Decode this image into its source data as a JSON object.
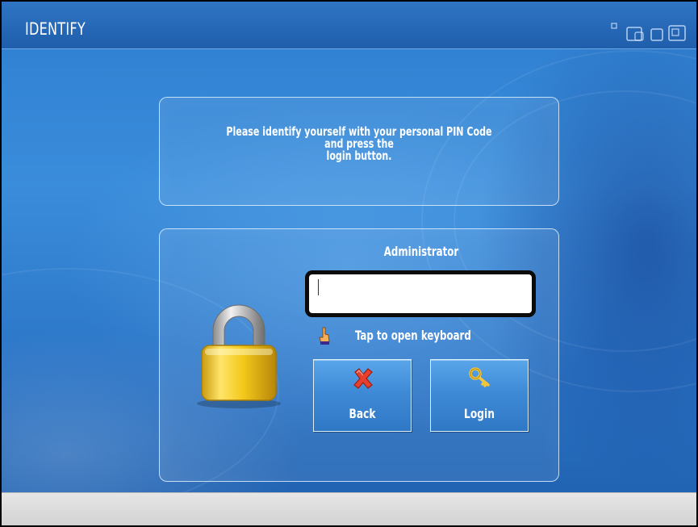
{
  "window": {
    "title": "IDENTIFY"
  },
  "message": {
    "lines": [
      "Please identify yourself with your personal PIN Code",
      "and press the",
      "login button."
    ]
  },
  "login": {
    "user_label": "Administrator",
    "pin_value": "",
    "keyboard_hint": "Tap to open keyboard",
    "back_label": "Back",
    "login_label": "Login"
  },
  "icons": {
    "lock": "padlock-icon",
    "hint": "pointing-hand-icon",
    "back": "red-x-icon",
    "login": "key-icon",
    "window_controls": "window-arrange-icons"
  },
  "colors": {
    "background": "#2f7ed0",
    "titlebar": "#1f5eab",
    "text": "#ffffff",
    "input_border": "#0b0b0b",
    "button": "#3f8ad6",
    "bottom_bar": "#dcdcdc"
  }
}
